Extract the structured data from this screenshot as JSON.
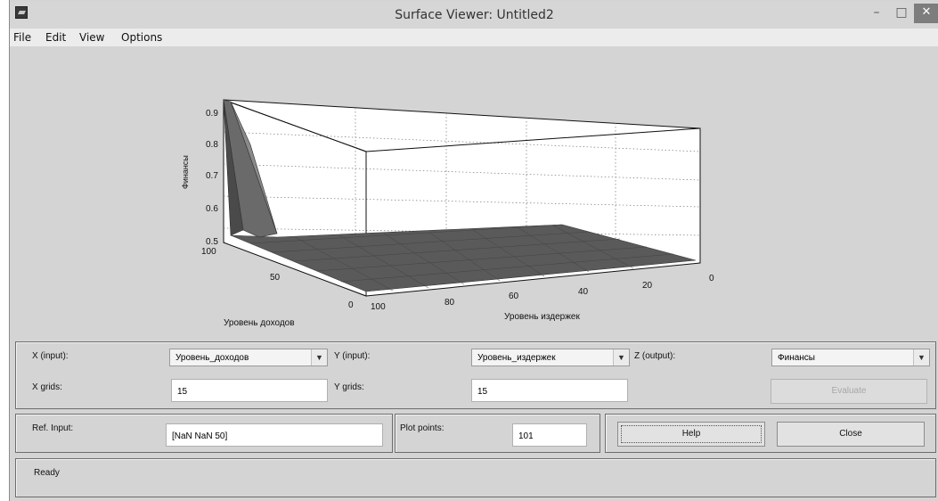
{
  "window": {
    "title": "Surface Viewer: Untitled2",
    "minimize_glyph": "–",
    "maximize_glyph": "□",
    "close_glyph": "✕"
  },
  "menu": [
    "File",
    "Edit",
    "View",
    "Options"
  ],
  "plot": {
    "z_label": "Финансы",
    "x_label": "Уровень доходов",
    "y_label": "Уровень издержек",
    "z_ticks": [
      "0.9",
      "0.8",
      "0.7",
      "0.6",
      "0.5"
    ],
    "x_ticks": [
      "100",
      "50",
      "0"
    ],
    "y_ticks": [
      "100",
      "80",
      "60",
      "40",
      "20",
      "0"
    ],
    "surface_color": "#555555"
  },
  "controls": {
    "x_input_label": "X (input):",
    "x_input_value": "Уровень_доходов",
    "y_input_label": "Y (input):",
    "y_input_value": "Уровень_издержек",
    "z_output_label": "Z (output):",
    "z_output_value": "Финансы",
    "x_grids_label": "X grids:",
    "x_grids_value": "15",
    "y_grids_label": "Y grids:",
    "y_grids_value": "15",
    "evaluate_label": "Evaluate",
    "ref_input_label": "Ref. Input:",
    "ref_input_value": "[NaN NaN 50]",
    "plot_points_label": "Plot points:",
    "plot_points_value": "101",
    "help_label": "Help",
    "close_label": "Close",
    "dropdown_icon": "chevron-down-icon"
  },
  "status": {
    "text": "Ready"
  }
}
